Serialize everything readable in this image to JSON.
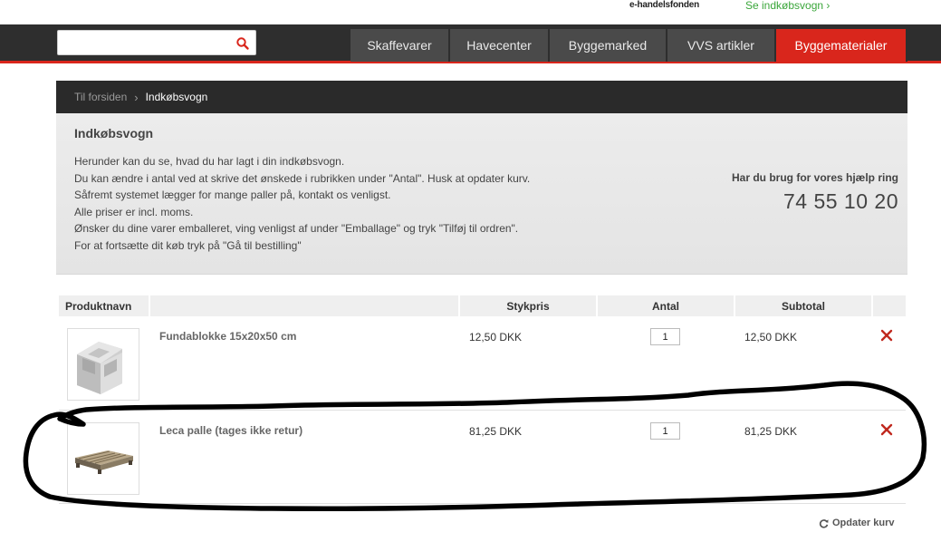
{
  "topbar": {
    "ehandel_prefix": "e-",
    "ehandel_rest": "handelsfonden",
    "cart_link": "Se indkøbsvogn ›"
  },
  "search": {
    "placeholder": "",
    "value": ""
  },
  "nav": {
    "tabs": [
      {
        "label": "Skaffevarer",
        "active": false
      },
      {
        "label": "Havecenter",
        "active": false
      },
      {
        "label": "Byggemarked",
        "active": false
      },
      {
        "label": "VVS artikler",
        "active": false
      },
      {
        "label": "Byggematerialer",
        "active": true
      }
    ],
    "accent_color": "#d9261c"
  },
  "breadcrumb": {
    "home": "Til forsiden",
    "current": "Indkøbsvogn"
  },
  "info": {
    "title": "Indkøbsvogn",
    "lines": [
      "Herunder kan du se, hvad du har lagt i din indkøbsvogn.",
      "Du kan ændre i antal ved at skrive det ønskede i rubrikken under \"Antal\". Husk at opdater kurv.",
      "Såfremt systemet lægger for mange paller på, kontakt os venligst.",
      "Alle priser er incl. moms.",
      "Ønsker du dine varer emballeret, ving venligst af under \"Emballage\" og tryk \"Tilføj til ordren\".",
      "For at fortsætte dit køb tryk på \"Gå til bestilling\""
    ],
    "help_label": "Har du brug for vores hjælp ring",
    "help_phone": "74 55 10 20"
  },
  "table": {
    "headers": {
      "product": "Produktnavn",
      "price": "Stykpris",
      "qty": "Antal",
      "subtotal": "Subtotal"
    },
    "rows": [
      {
        "name": "Fundablokke 15x20x50 cm",
        "price": "12,50 DKK",
        "qty": "1",
        "subtotal": "12,50 DKK",
        "thumb": "concrete-block"
      },
      {
        "name": "Leca palle (tages ikke retur)",
        "price": "81,25 DKK",
        "qty": "1",
        "subtotal": "81,25 DKK",
        "thumb": "wooden-pallet"
      }
    ],
    "update_label": "Opdater kurv"
  },
  "colors": {
    "remove_icon": "#c0281e",
    "cart_link": "#3aa63a",
    "annotation_stroke": "#000000"
  }
}
